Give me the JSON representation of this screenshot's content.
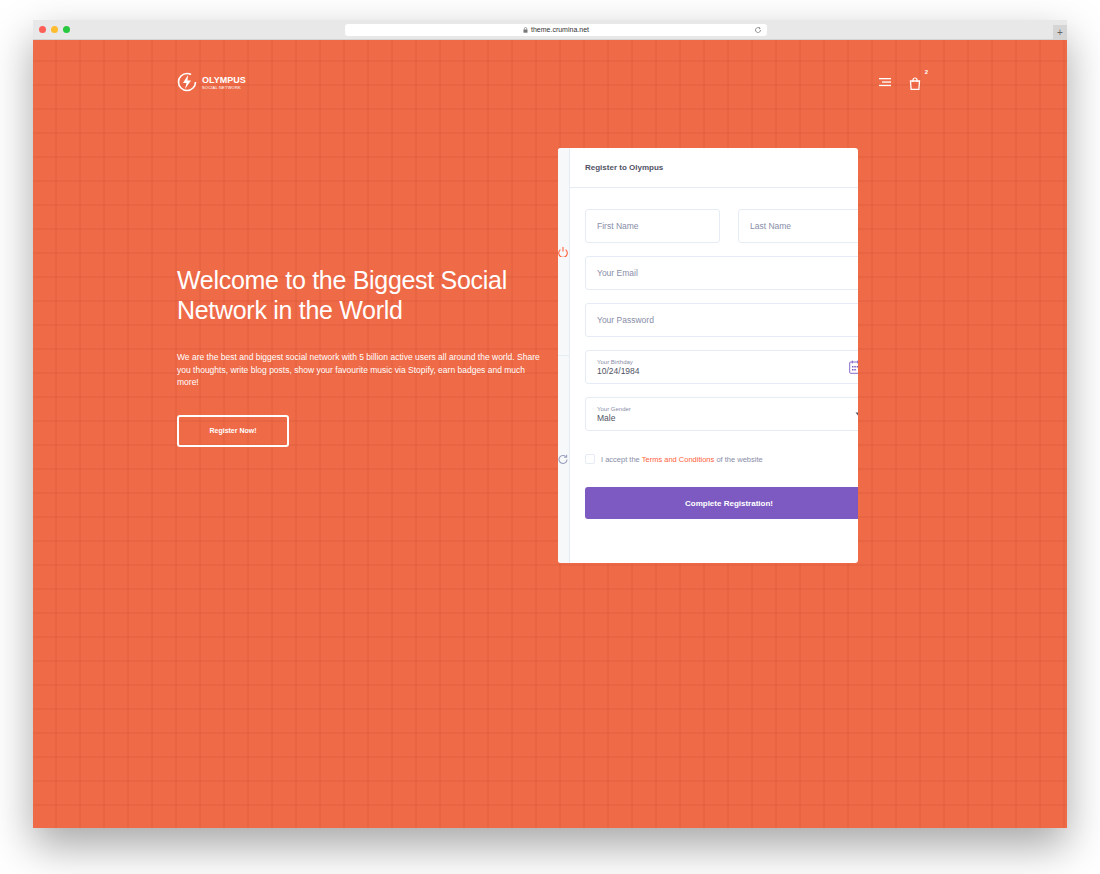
{
  "browser": {
    "url": "theme.crumina.net",
    "new_tab_button": "+"
  },
  "header": {
    "logo_title": "OLYMPUS",
    "logo_subtitle": "SOCIAL NETWORK",
    "cart_badge": "2"
  },
  "hero": {
    "title": "Welcome to the Biggest Social Network in the World",
    "text": "We are the best and biggest social network with 5 billion active users all around the world. Share you thoughts, write blog posts, show your favourite music via Stopify, earn badges and much more!",
    "button": "Register Now!"
  },
  "form": {
    "side_tabs": [
      {
        "selected": true
      },
      {
        "selected": false
      }
    ],
    "title": "Register to Olympus",
    "first_name": {
      "placeholder": "First Name"
    },
    "last_name": {
      "placeholder": "Last Name"
    },
    "email": {
      "placeholder": "Your Email"
    },
    "password": {
      "placeholder": "Your Password"
    },
    "birthday": {
      "label": "Your Birthday",
      "value": "10/24/1984"
    },
    "gender": {
      "label": "Your Gender",
      "value": "Male"
    },
    "terms": {
      "checked": false,
      "before": "I accept the",
      "link": "Terms and Conditions",
      "after": "of the website"
    },
    "submit": "Complete Registration!"
  }
}
